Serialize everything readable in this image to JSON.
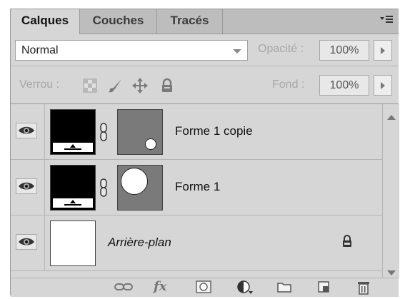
{
  "tabs": [
    {
      "label": "Calques",
      "active": true
    },
    {
      "label": "Couches",
      "active": false
    },
    {
      "label": "Tracés",
      "active": false
    }
  ],
  "icons": {
    "panel_menu": "panel-menu-icon",
    "visibility": "eye-icon",
    "link": "chain-link-icon",
    "locked": "lock-icon"
  },
  "blend_mode": {
    "value": "Normal"
  },
  "opacity": {
    "label": "Opacité :",
    "value": "100%"
  },
  "lock": {
    "label": "Verrou :"
  },
  "fill": {
    "label": "Fond :",
    "value": "100%"
  },
  "layers": [
    {
      "name": "Forme 1 copie",
      "italic": false,
      "has_mask": true,
      "circle": "small",
      "locked": false
    },
    {
      "name": "Forme 1",
      "italic": false,
      "has_mask": true,
      "circle": "large",
      "locked": false
    },
    {
      "name": "Arrière-plan",
      "italic": true,
      "has_mask": false,
      "locked": true
    }
  ],
  "footer_buttons": [
    "link-layers",
    "fx",
    "add-mask",
    "adjustment",
    "new-group",
    "new-layer",
    "delete"
  ],
  "footer": {
    "fx_label": "fx"
  },
  "colors": {
    "panel_bg": "#d6d6d6",
    "tab_bar": "#bdbdbd",
    "text_dim": "#a7a7a7"
  }
}
